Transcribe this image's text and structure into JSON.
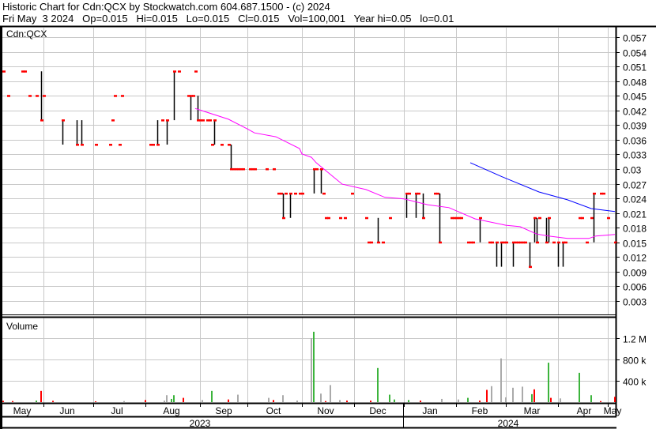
{
  "header": {
    "line1": "Historic Chart for Cdn:QCX by Stockwatch.com 604.687.1500 - (c) 2024",
    "line2": "Fri May  3 2024   Op=0.015   Hi=0.015   Lo=0.015   Cl=0.015   Vol=100,001   Year hi=0.05   lo=0.01"
  },
  "colors": {
    "up": "#3cb43c",
    "down": "#ff0000",
    "flat": "#aaaaaa",
    "tick": "#ff0000",
    "ma_short": "#ff00ff",
    "ma_long": "#0000ff",
    "grid": "#c8c8c8"
  },
  "chart_data": {
    "type": "ohlc+volume",
    "symbol_label": "Cdn:QCX",
    "volume_label": "Volume",
    "x_unit": "trading day index (May 2023 - May 2024)",
    "price_ticks": [
      "0.057",
      "0.054",
      "0.051",
      "0.048",
      "0.045",
      "0.042",
      "0.039",
      "0.036",
      "0.033",
      "0.03",
      "0.027",
      "0.024",
      "0.021",
      "0.018",
      "0.015",
      "0.012",
      "0.009",
      "0.006",
      "0.003"
    ],
    "price_range": [
      0.0,
      0.0582
    ],
    "volume_ticks": [
      {
        "label": "1.2 M",
        "value": 1200
      },
      {
        "label": "800 k",
        "value": 800
      },
      {
        "label": "400 k",
        "value": 400
      }
    ],
    "volume_unit": "thousands",
    "months": [
      {
        "label": "May",
        "day": 9
      },
      {
        "label": "Jun",
        "day": 28
      },
      {
        "label": "Jul",
        "day": 49
      },
      {
        "label": "Aug",
        "day": 72
      },
      {
        "label": "Sep",
        "day": 94
      },
      {
        "label": "Oct",
        "day": 115
      },
      {
        "label": "Nov",
        "day": 137
      },
      {
        "label": "Dec",
        "day": 159
      },
      {
        "label": "Jan",
        "day": 181
      },
      {
        "label": "Feb",
        "day": 202
      },
      {
        "label": "Mar",
        "day": 224
      },
      {
        "label": "Apr",
        "day": 246
      },
      {
        "label": "May",
        "day": 258
      }
    ],
    "grid_days": [
      18,
      39,
      61,
      84,
      104,
      127,
      149,
      170,
      192,
      213,
      235,
      256
    ],
    "years": [
      {
        "label": "2023"
      },
      {
        "label": "2024"
      }
    ],
    "bars": [
      [
        1,
        0.05,
        0.05,
        0.05
      ],
      [
        3,
        0.045,
        0.045,
        0.045
      ],
      [
        9,
        0.05,
        0.05,
        0.05
      ],
      [
        10,
        0.05,
        0.05,
        0.05
      ],
      [
        12,
        0.045,
        0.045,
        0.045
      ],
      [
        15,
        0.045,
        0.045,
        0.045
      ],
      [
        17,
        0.05,
        0.04,
        0.04
      ],
      [
        18,
        0.045,
        0.045,
        0.045
      ],
      [
        26,
        0.04,
        0.035,
        0.04
      ],
      [
        32,
        0.04,
        0.035,
        0.035
      ],
      [
        34,
        0.04,
        0.035,
        0.035
      ],
      [
        40,
        0.035,
        0.035,
        0.035
      ],
      [
        46,
        0.035,
        0.035,
        0.035
      ],
      [
        47,
        0.04,
        0.04,
        0.04
      ],
      [
        48,
        0.045,
        0.045,
        0.045
      ],
      [
        50,
        0.035,
        0.035,
        0.035
      ],
      [
        51,
        0.045,
        0.045,
        0.045
      ],
      [
        63,
        0.035,
        0.035,
        0.035
      ],
      [
        64,
        0.035,
        0.035,
        0.035
      ],
      [
        66,
        0.04,
        0.035,
        0.035
      ],
      [
        68,
        0.04,
        0.04,
        0.04
      ],
      [
        70,
        0.04,
        0.035,
        0.04
      ],
      [
        73,
        0.05,
        0.04,
        0.05
      ],
      [
        75,
        0.05,
        0.05,
        0.05
      ],
      [
        79,
        0.045,
        0.045,
        0.045
      ],
      [
        80,
        0.045,
        0.04,
        0.045
      ],
      [
        81,
        0.045,
        0.045,
        0.045
      ],
      [
        82,
        0.05,
        0.05,
        0.05
      ],
      [
        83,
        0.045,
        0.04,
        0.04
      ],
      [
        84,
        0.04,
        0.04,
        0.04
      ],
      [
        85,
        0.04,
        0.04,
        0.04
      ],
      [
        87,
        0.04,
        0.04,
        0.04
      ],
      [
        88,
        0.04,
        0.04,
        0.04
      ],
      [
        89,
        0.035,
        0.035,
        0.035
      ],
      [
        90,
        0.04,
        0.035,
        0.04
      ],
      [
        93,
        0.035,
        0.035,
        0.035
      ],
      [
        96,
        0.035,
        0.035,
        0.035
      ],
      [
        97,
        0.035,
        0.03,
        0.03
      ],
      [
        98,
        0.03,
        0.03,
        0.03
      ],
      [
        99,
        0.03,
        0.03,
        0.03
      ],
      [
        100,
        0.03,
        0.03,
        0.03
      ],
      [
        101,
        0.03,
        0.03,
        0.03
      ],
      [
        102,
        0.03,
        0.03,
        0.03
      ],
      [
        105,
        0.03,
        0.03,
        0.03
      ],
      [
        106,
        0.03,
        0.03,
        0.03
      ],
      [
        107,
        0.03,
        0.03,
        0.03
      ],
      [
        112,
        0.03,
        0.03,
        0.03
      ],
      [
        115,
        0.03,
        0.03,
        0.03
      ],
      [
        117,
        0.025,
        0.025,
        0.025
      ],
      [
        118,
        0.025,
        0.025,
        0.025
      ],
      [
        119,
        0.025,
        0.02,
        0.02
      ],
      [
        120,
        0.025,
        0.025,
        0.025
      ],
      [
        122,
        0.025,
        0.02,
        0.025
      ],
      [
        124,
        0.025,
        0.025,
        0.025
      ],
      [
        126,
        0.025,
        0.025,
        0.025
      ],
      [
        127,
        0.025,
        0.025,
        0.025
      ],
      [
        132,
        0.03,
        0.025,
        0.03
      ],
      [
        133,
        0.03,
        0.03,
        0.03
      ],
      [
        135,
        0.03,
        0.025,
        0.03
      ],
      [
        136,
        0.025,
        0.025,
        0.025
      ],
      [
        137,
        0.02,
        0.02,
        0.02
      ],
      [
        138,
        0.02,
        0.02,
        0.02
      ],
      [
        143,
        0.02,
        0.02,
        0.02
      ],
      [
        145,
        0.02,
        0.02,
        0.02
      ],
      [
        148,
        0.025,
        0.025,
        0.025
      ],
      [
        154,
        0.02,
        0.02,
        0.02
      ],
      [
        155,
        0.015,
        0.015,
        0.015
      ],
      [
        156,
        0.015,
        0.015,
        0.015
      ],
      [
        159,
        0.02,
        0.015,
        0.015
      ],
      [
        161,
        0.015,
        0.015,
        0.015
      ],
      [
        164,
        0.02,
        0.02,
        0.02
      ],
      [
        171,
        0.025,
        0.02,
        0.025
      ],
      [
        172,
        0.025,
        0.025,
        0.025
      ],
      [
        175,
        0.025,
        0.02,
        0.025
      ],
      [
        176,
        0.025,
        0.025,
        0.025
      ],
      [
        178,
        0.025,
        0.02,
        0.02
      ],
      [
        183,
        0.025,
        0.025,
        0.025
      ],
      [
        184,
        0.025,
        0.025,
        0.025
      ],
      [
        185,
        0.025,
        0.015,
        0.015
      ],
      [
        190,
        0.02,
        0.02,
        0.02
      ],
      [
        191,
        0.02,
        0.02,
        0.02
      ],
      [
        192,
        0.02,
        0.02,
        0.02
      ],
      [
        193,
        0.02,
        0.02,
        0.02
      ],
      [
        194,
        0.02,
        0.02,
        0.02
      ],
      [
        197,
        0.015,
        0.015,
        0.015
      ],
      [
        198,
        0.015,
        0.015,
        0.015
      ],
      [
        199,
        0.015,
        0.015,
        0.015
      ],
      [
        202,
        0.02,
        0.015,
        0.02
      ],
      [
        206,
        0.015,
        0.015,
        0.015
      ],
      [
        207,
        0.015,
        0.015,
        0.015
      ],
      [
        209,
        0.015,
        0.01,
        0.015
      ],
      [
        211,
        0.015,
        0.01,
        0.015
      ],
      [
        212,
        0.015,
        0.015,
        0.015
      ],
      [
        213,
        0.015,
        0.015,
        0.015
      ],
      [
        216,
        0.015,
        0.01,
        0.015
      ],
      [
        217,
        0.015,
        0.015,
        0.015
      ],
      [
        218,
        0.015,
        0.015,
        0.015
      ],
      [
        219,
        0.015,
        0.015,
        0.015
      ],
      [
        220,
        0.015,
        0.015,
        0.015
      ],
      [
        221,
        0.015,
        0.015,
        0.015
      ],
      [
        223,
        0.015,
        0.01,
        0.01
      ],
      [
        225,
        0.02,
        0.015,
        0.02
      ],
      [
        226,
        0.02,
        0.015,
        0.015
      ],
      [
        227,
        0.02,
        0.02,
        0.02
      ],
      [
        230,
        0.02,
        0.015,
        0.015
      ],
      [
        231,
        0.02,
        0.015,
        0.02
      ],
      [
        233,
        0.015,
        0.015,
        0.015
      ],
      [
        235,
        0.015,
        0.01,
        0.015
      ],
      [
        237,
        0.015,
        0.01,
        0.015
      ],
      [
        238,
        0.015,
        0.015,
        0.015
      ],
      [
        244,
        0.02,
        0.02,
        0.02
      ],
      [
        245,
        0.02,
        0.02,
        0.02
      ],
      [
        247,
        0.015,
        0.015,
        0.015
      ],
      [
        249,
        0.02,
        0.02,
        0.02
      ],
      [
        250,
        0.025,
        0.015,
        0.025
      ],
      [
        253,
        0.025,
        0.025,
        0.025
      ],
      [
        254,
        0.025,
        0.025,
        0.025
      ],
      [
        256,
        0.02,
        0.02,
        0.02
      ],
      [
        259,
        0.015,
        0.015,
        0.015
      ]
    ],
    "ma_short": [
      [
        82,
        0.0424
      ],
      [
        96,
        0.0402
      ],
      [
        104,
        0.0382
      ],
      [
        107,
        0.0374
      ],
      [
        116,
        0.0366
      ],
      [
        126,
        0.0342
      ],
      [
        127,
        0.0331
      ],
      [
        131,
        0.0324
      ],
      [
        133,
        0.0313
      ],
      [
        140,
        0.0285
      ],
      [
        144,
        0.0269
      ],
      [
        154,
        0.0258
      ],
      [
        162,
        0.0242
      ],
      [
        170,
        0.0239
      ],
      [
        180,
        0.0227
      ],
      [
        189,
        0.0221
      ],
      [
        200,
        0.0198
      ],
      [
        213,
        0.0185
      ],
      [
        219,
        0.0182
      ],
      [
        226,
        0.0167
      ],
      [
        231,
        0.0163
      ],
      [
        239,
        0.0158
      ],
      [
        248,
        0.0158
      ],
      [
        251,
        0.0163
      ],
      [
        259,
        0.0166
      ]
    ],
    "ma_long": [
      [
        198,
        0.0313
      ],
      [
        211,
        0.0285
      ],
      [
        227,
        0.0253
      ],
      [
        239,
        0.0237
      ],
      [
        249,
        0.0219
      ],
      [
        259,
        0.0213
      ]
    ],
    "volume": [
      [
        1,
        25,
        "down"
      ],
      [
        5,
        20,
        "down"
      ],
      [
        15,
        30,
        "up"
      ],
      [
        17,
        210,
        "down"
      ],
      [
        22,
        25,
        "down"
      ],
      [
        40,
        15,
        "down"
      ],
      [
        52,
        20,
        "flat"
      ],
      [
        61,
        40,
        "down"
      ],
      [
        69,
        30,
        "flat"
      ],
      [
        70,
        130,
        "flat"
      ],
      [
        72,
        60,
        "up"
      ],
      [
        73,
        130,
        "up"
      ],
      [
        77,
        80,
        "down"
      ],
      [
        85,
        40,
        "flat"
      ],
      [
        89,
        210,
        "up"
      ],
      [
        96,
        50,
        "down"
      ],
      [
        100,
        140,
        "flat"
      ],
      [
        113,
        80,
        "flat"
      ],
      [
        115,
        40,
        "down"
      ],
      [
        119,
        130,
        "flat"
      ],
      [
        125,
        30,
        "flat"
      ],
      [
        131,
        1200,
        "flat"
      ],
      [
        132,
        1320,
        "up"
      ],
      [
        135,
        160,
        "flat"
      ],
      [
        137,
        20,
        "down"
      ],
      [
        139,
        320,
        "flat"
      ],
      [
        143,
        40,
        "flat"
      ],
      [
        146,
        30,
        "down"
      ],
      [
        156,
        30,
        "down"
      ],
      [
        159,
        640,
        "up"
      ],
      [
        164,
        140,
        "up"
      ],
      [
        166,
        50,
        "up"
      ],
      [
        172,
        40,
        "up"
      ],
      [
        177,
        30,
        "down"
      ],
      [
        186,
        60,
        "flat"
      ],
      [
        193,
        50,
        "flat"
      ],
      [
        197,
        80,
        "up"
      ],
      [
        202,
        30,
        "down"
      ],
      [
        205,
        230,
        "down"
      ],
      [
        207,
        300,
        "flat"
      ],
      [
        211,
        820,
        "flat"
      ],
      [
        213,
        90,
        "flat"
      ],
      [
        216,
        270,
        "flat"
      ],
      [
        220,
        290,
        "flat"
      ],
      [
        224,
        150,
        "up"
      ],
      [
        225,
        240,
        "down"
      ],
      [
        231,
        740,
        "up"
      ],
      [
        232,
        80,
        "down"
      ],
      [
        236,
        70,
        "flat"
      ],
      [
        244,
        550,
        "up"
      ],
      [
        249,
        130,
        "up"
      ],
      [
        253,
        20,
        "down"
      ],
      [
        259,
        100,
        "down"
      ]
    ]
  }
}
